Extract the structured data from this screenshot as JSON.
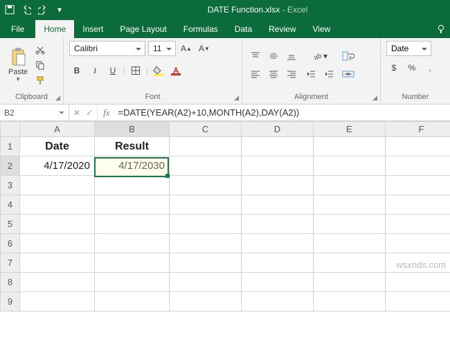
{
  "title": {
    "filename": "DATE Function.xlsx",
    "app": "Excel"
  },
  "qat": {
    "save": "save-icon",
    "undo": "undo-icon",
    "redo": "redo-icon"
  },
  "tabs": [
    "File",
    "Home",
    "Insert",
    "Page Layout",
    "Formulas",
    "Data",
    "Review",
    "View"
  ],
  "active_tab": "Home",
  "ribbon": {
    "clipboard": {
      "label": "Clipboard",
      "paste": "Paste"
    },
    "font": {
      "label": "Font",
      "name": "Calibri",
      "size": "11",
      "bold": "B",
      "italic": "I",
      "underline": "U"
    },
    "alignment": {
      "label": "Alignment"
    },
    "number": {
      "label": "Number",
      "format": "Date",
      "currency": "$",
      "percent": "%",
      "comma": ","
    }
  },
  "namebox": "B2",
  "formula": "=DATE(YEAR(A2)+10,MONTH(A2),DAY(A2))",
  "fx": "fx",
  "columns": [
    "A",
    "B",
    "C",
    "D",
    "E",
    "F"
  ],
  "rows": [
    "1",
    "2",
    "3",
    "4",
    "5",
    "6",
    "7",
    "8",
    "9"
  ],
  "cells": {
    "A1": "Date",
    "B1": "Result",
    "A2": "4/17/2020",
    "B2": "4/17/2030"
  },
  "selection": {
    "col": "B",
    "row": "2"
  },
  "watermark": "wsxnds.com",
  "chart_data": {
    "type": "table",
    "title": "",
    "columns": [
      "Date",
      "Result"
    ],
    "rows": [
      [
        "4/17/2020",
        "4/17/2030"
      ]
    ]
  }
}
